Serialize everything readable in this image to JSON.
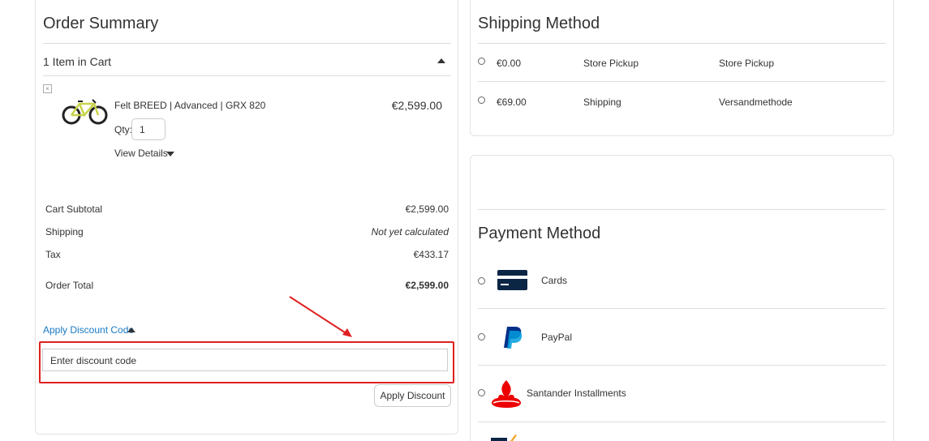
{
  "order_summary": {
    "title": "Order Summary",
    "items_in_cart": "1 Item in Cart",
    "item": {
      "name": "Felt BREED | Advanced | GRX 820",
      "price": "€2,599.00",
      "qty_label": "Qty:",
      "qty_value": "1",
      "view_details": "View Details",
      "remove_icon": "close-icon",
      "image_icon": "bicycle-icon"
    },
    "totals": {
      "subtotal_label": "Cart Subtotal",
      "subtotal_value": "€2,599.00",
      "shipping_label": "Shipping",
      "shipping_value": "Not yet calculated",
      "tax_label": "Tax",
      "tax_value": "€433.17",
      "order_total_label": "Order Total",
      "order_total_value": "€2,599.00"
    },
    "discount": {
      "toggle_label": "Apply Discount Code",
      "input_placeholder": "Enter discount code",
      "apply_button": "Apply Discount"
    }
  },
  "shipping_method": {
    "title": "Shipping Method",
    "options": [
      {
        "price": "€0.00",
        "method": "Store Pickup",
        "carrier": "Store Pickup"
      },
      {
        "price": "€69.00",
        "method": "Shipping",
        "carrier": "Versandmethode"
      }
    ]
  },
  "payment_method": {
    "title": "Payment Method",
    "options": [
      {
        "label": "Cards",
        "icon": "credit-card-icon"
      },
      {
        "label": "PayPal",
        "icon": "paypal-icon"
      },
      {
        "label": "Santander Installments",
        "icon": "santander-flame-icon"
      }
    ]
  },
  "colors": {
    "link": "#1979c3",
    "highlight": "#e02020",
    "card_icon": "#0b2545",
    "paypal_dark": "#003087",
    "paypal_light": "#009cde",
    "santander": "#ec0000"
  }
}
